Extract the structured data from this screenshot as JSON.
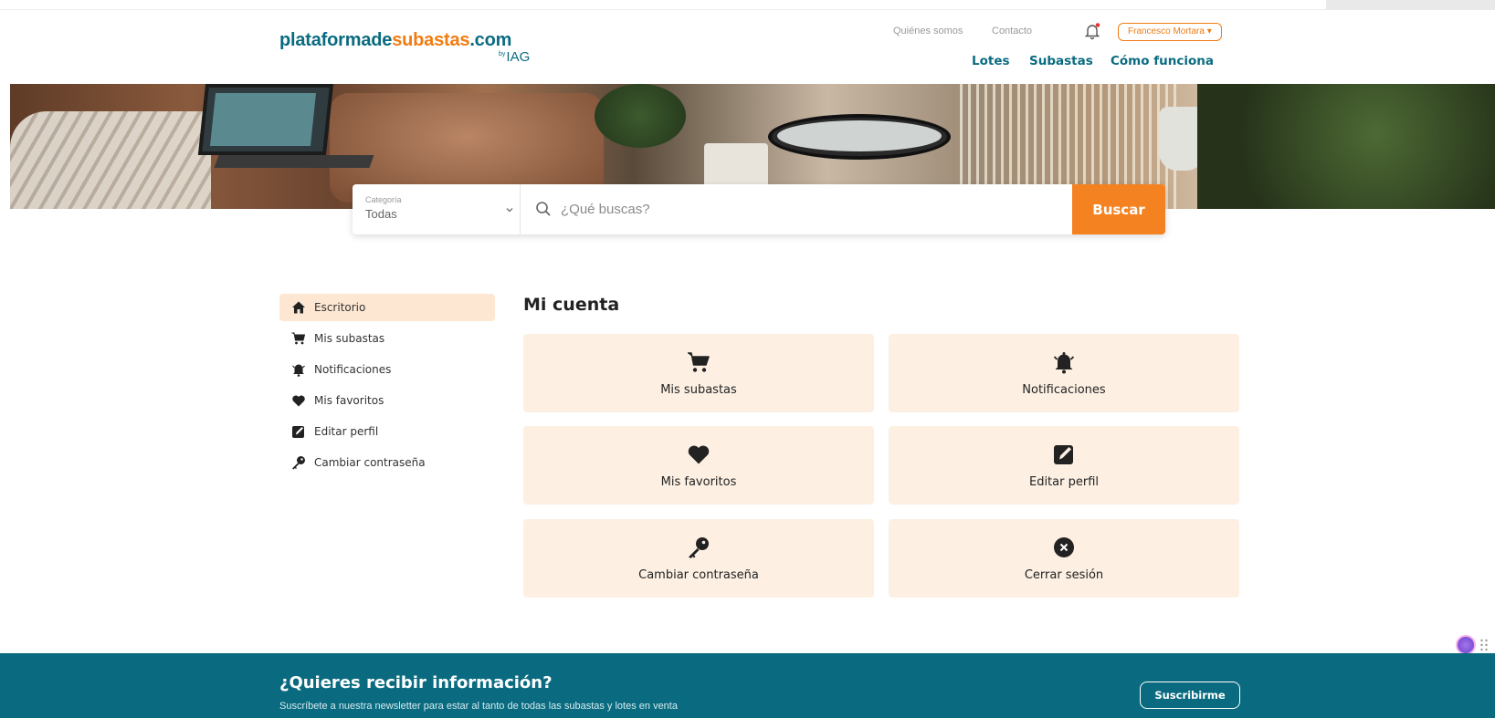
{
  "header": {
    "logo": {
      "part1": "plataforma",
      "part2": "de",
      "part3": "subastas",
      "part4": ".com",
      "by": "by",
      "brand": "IAG"
    },
    "util_links": [
      "Quiénes somos",
      "Contacto"
    ],
    "user_menu": "Francesco Mortara",
    "nav": [
      "Lotes",
      "Subastas",
      "Cómo funciona"
    ]
  },
  "search": {
    "category_label": "Categoría",
    "category_value": "Todas",
    "placeholder": "¿Qué buscas?",
    "button": "Buscar"
  },
  "sidebar": {
    "items": [
      {
        "label": "Escritorio",
        "icon": "home-icon",
        "active": true
      },
      {
        "label": "Mis subastas",
        "icon": "cart-icon"
      },
      {
        "label": "Notificaciones",
        "icon": "bell-icon"
      },
      {
        "label": "Mis favoritos",
        "icon": "heart-icon"
      },
      {
        "label": "Editar perfil",
        "icon": "edit-icon"
      },
      {
        "label": "Cambiar contraseña",
        "icon": "key-icon"
      }
    ]
  },
  "main": {
    "title": "Mi cuenta",
    "cards": [
      {
        "label": "Mis subastas",
        "icon": "cart-icon"
      },
      {
        "label": "Notificaciones",
        "icon": "bell-icon"
      },
      {
        "label": "Mis favoritos",
        "icon": "heart-icon"
      },
      {
        "label": "Editar perfil",
        "icon": "edit-icon"
      },
      {
        "label": "Cambiar contraseña",
        "icon": "key-icon"
      },
      {
        "label": "Cerrar sesión",
        "icon": "close-circle-icon"
      }
    ]
  },
  "footer": {
    "title": "¿Quieres recibir información?",
    "subtitle": "Suscríbete a nuestra newsletter para estar al tanto de todas las subastas y lotes en venta",
    "button": "Suscribirme"
  },
  "colors": {
    "brand_teal": "#0a6b80",
    "brand_orange": "#f07c12",
    "button_orange": "#f58220",
    "card_bg": "#fdf0e3",
    "active_bg": "#fde7d2"
  }
}
